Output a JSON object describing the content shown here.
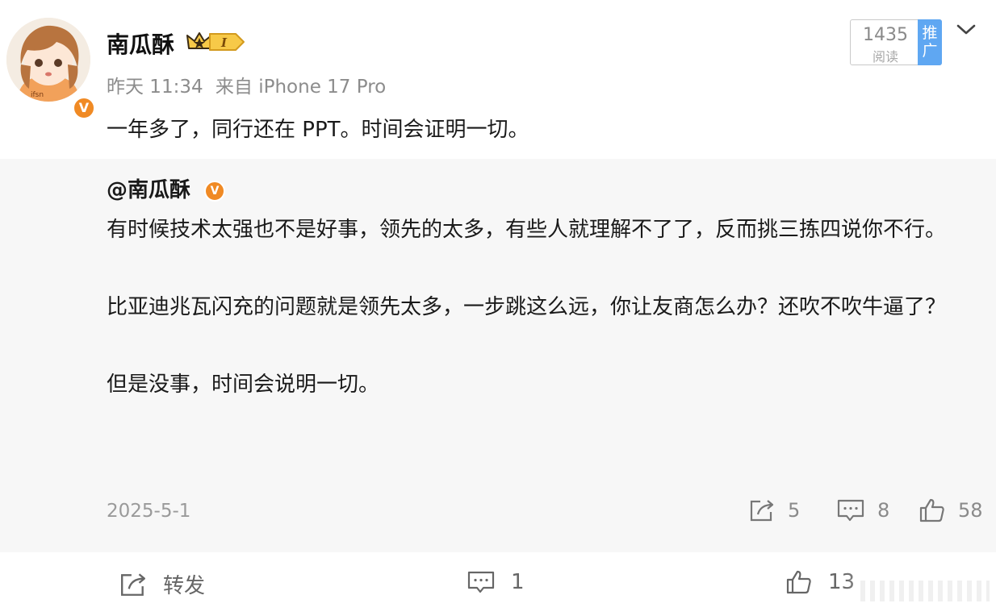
{
  "author": {
    "name": "南瓜酥",
    "level_badge": "I",
    "verified": "V"
  },
  "meta": {
    "time": "昨天 11:34",
    "source": "来自 iPhone 17 Pro"
  },
  "stats_box": {
    "read_count": "1435",
    "read_label": "阅读",
    "promo_label": "推广"
  },
  "post": {
    "text": "一年多了，同行还在 PPT。时间会证明一切。"
  },
  "repost": {
    "author": "@南瓜酥",
    "paragraphs": [
      "有时候技术太强也不是好事，领先的太多，有些人就理解不了了，反而挑三拣四说你不行。",
      "比亚迪兆瓦闪充的问题就是领先太多，一步跳这么远，你让友商怎么办？还吹不吹牛逼了？",
      "但是没事，时间会说明一切。"
    ],
    "date": "2025-5-1",
    "repost_count": "5",
    "comment_count": "8",
    "like_count": "58"
  },
  "footer": {
    "repost_label": "转发",
    "comment_count": "1",
    "like_count": "13"
  },
  "colors": {
    "verified_orange": "#f08a24",
    "promo_blue": "#5fa7f2",
    "repost_bg": "#f7f7f7",
    "meta_gray": "#8c8c8c"
  }
}
